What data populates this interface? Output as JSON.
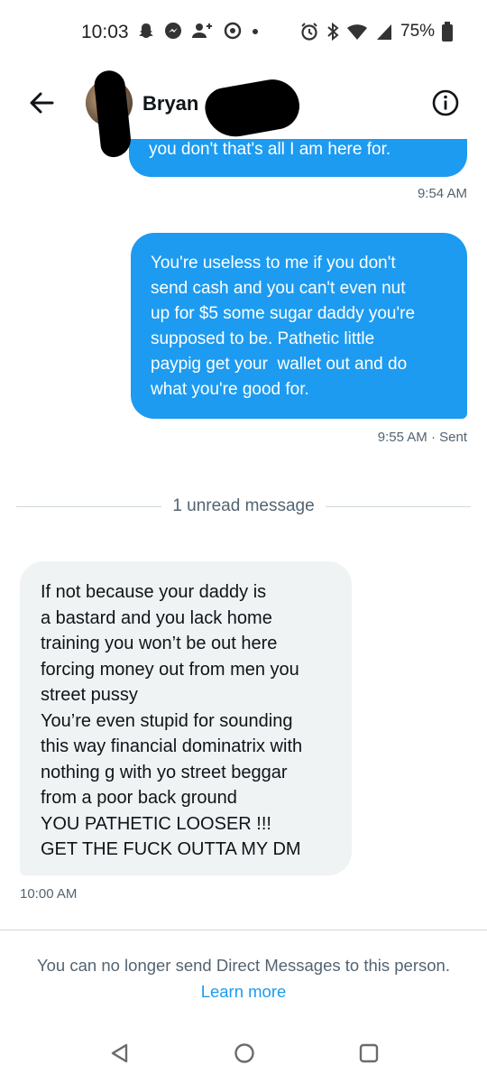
{
  "status_bar": {
    "time": "10:03",
    "battery": "75%"
  },
  "header": {
    "contact_name": "Bryan",
    "icons": [
      "back-arrow-icon",
      "info-icon"
    ]
  },
  "messages": [
    {
      "direction": "outgoing",
      "text": "you don't that's all I am here for.",
      "timestamp": "9:54 AM"
    },
    {
      "direction": "outgoing",
      "text": "You're useless to me if you don't send cash and you can't even nut up for $5 some sugar daddy you're supposed to be. Pathetic little paypig get your  wallet out and do what you're good for.",
      "lines": [
        "You're useless to me if you don't",
        "send cash and you can't even nut",
        "up for $5 some sugar daddy you're",
        "supposed to be. Pathetic little",
        "paypig get your  wallet out and do",
        "what you're good for."
      ],
      "timestamp": "9:55 AM · Sent"
    },
    {
      "direction": "incoming",
      "lines": [
        "If not because your daddy is",
        "a bastard and you lack home",
        "training you won’t be out here",
        "forcing money out from men you",
        "street pussy",
        "You’re even stupid for sounding",
        "this way financial dominatrix with",
        "nothing g with yo street beggar",
        "from a poor back ground",
        "YOU PATHETIC LOOSER !!!",
        "GET THE FUCK OUTTA MY DM"
      ],
      "timestamp": "10:00 AM"
    }
  ],
  "unread_divider": "1 unread message",
  "footer": {
    "notice": "You can no longer send Direct Messages to this person.",
    "link": "Learn more"
  },
  "colors": {
    "accent": "#1d9bf0",
    "incoming_bubble": "#eff3f4",
    "secondary_text": "#536471"
  }
}
